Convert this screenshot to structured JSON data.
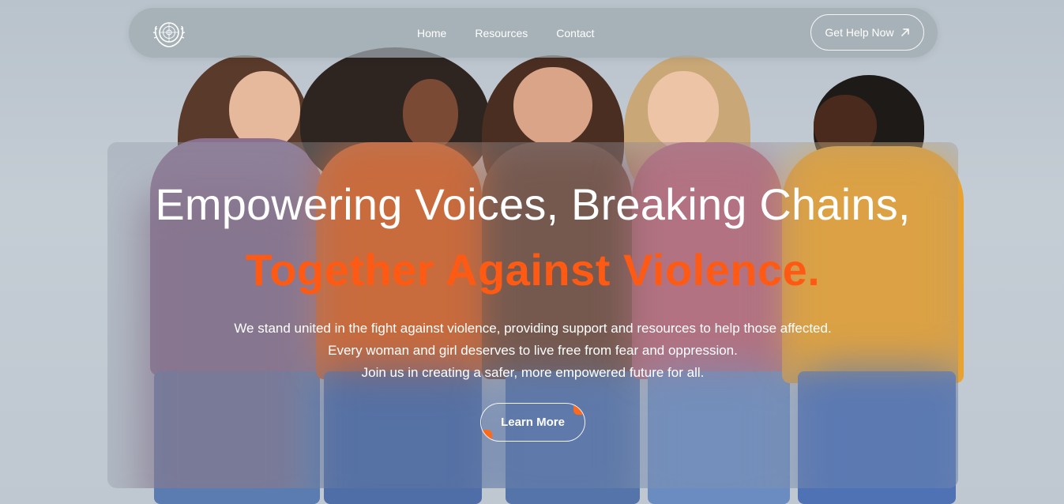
{
  "brand": {
    "logo_icon": "un-emblem-icon"
  },
  "nav": {
    "links": [
      "Home",
      "Resources",
      "Contact"
    ],
    "cta_label": "Get Help Now",
    "cta_icon": "arrow-up-right-icon"
  },
  "hero": {
    "headline": "Empowering Voices, Breaking Chains,",
    "subheadline": "Together Against Violence.",
    "description_lines": [
      "We stand united in the fight against violence, providing support and resources to help those affected.",
      "Every woman and girl deserves to live free from fear and oppression.",
      "Join us in creating a safer, more empowered future for all."
    ],
    "button_label": "Learn More"
  },
  "colors": {
    "accent": "#ff5a14",
    "text": "#ffffff",
    "navbar": "#a0aab0"
  }
}
